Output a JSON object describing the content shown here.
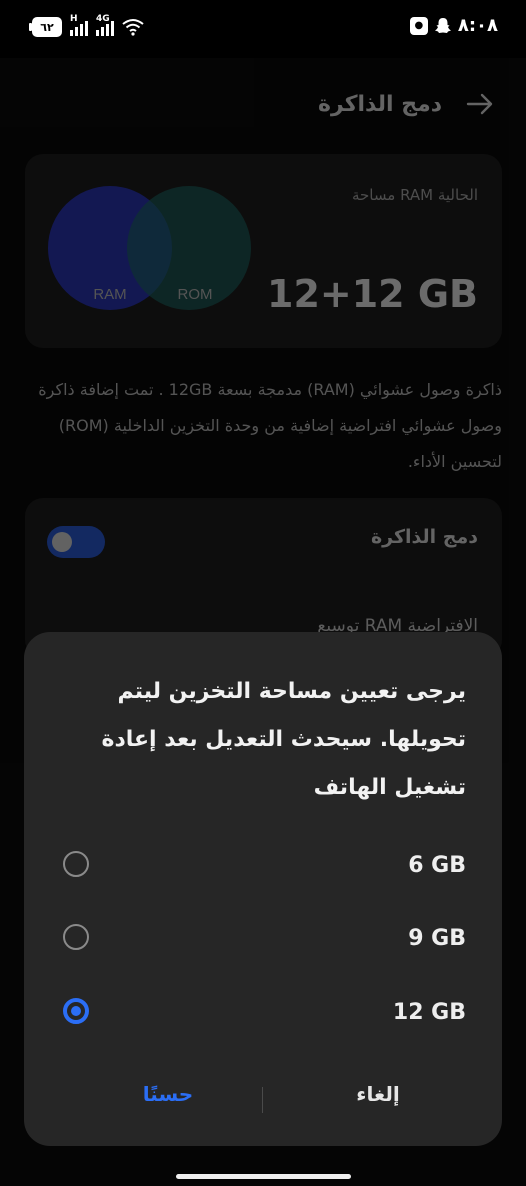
{
  "status_bar": {
    "time": "٨:٠٨",
    "battery": "٦٢",
    "net1": "H",
    "net2": "4G"
  },
  "header": {
    "title": "دمج الذاكرة"
  },
  "memory_card": {
    "label": "مساحة RAM الحالية",
    "value": "12+12 GB",
    "venn_left": "RAM",
    "venn_right": "ROM"
  },
  "description": "ذاكرة وصول عشوائي (RAM) مدمجة بسعة 12GB . تمت إضافة ذاكرة وصول عشوائي افتراضية إضافية من وحدة التخزين الداخلية (ROM) لتحسين الأداء.",
  "settings": {
    "toggle_label": "دمج الذاكرة",
    "toggle_on": true,
    "row_label": "توسيع RAM الافتراضية"
  },
  "dialog": {
    "message": "يرجى تعيين مساحة التخزين ليتم تحويلها. سيحدث التعديل بعد إعادة تشغيل الهاتف",
    "options": [
      {
        "label": "6 GB",
        "selected": false
      },
      {
        "label": "9 GB",
        "selected": false
      },
      {
        "label": "12 GB",
        "selected": true
      }
    ],
    "ok_label": "حسنًا",
    "cancel_label": "إلغاء"
  },
  "colors": {
    "accent": "#2b6ef5",
    "dialog_bg": "#262626",
    "card_bg": "#1d1d1d"
  }
}
